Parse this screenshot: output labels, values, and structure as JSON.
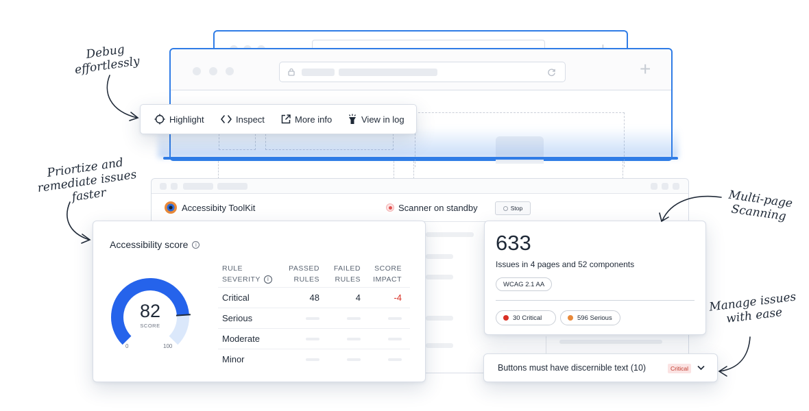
{
  "annotations": {
    "debug": "Debug effortlessly",
    "prioritize": "Priortize and remediate issues faster",
    "multipage": "Multi-page Scanning",
    "manage": "Manage issues with ease"
  },
  "toolbar": {
    "highlight": "Highlight",
    "inspect": "Inspect",
    "more_info": "More info",
    "view_in_log": "View in log"
  },
  "toolkit": {
    "title": "Accessibity ToolKit",
    "status": "Scanner on standby",
    "stop": "Stop"
  },
  "score_card": {
    "title": "Accessibility score",
    "score": "82",
    "score_label": "SCORE",
    "score_fraction": 0.82,
    "gauge_min": "0",
    "gauge_max": "100",
    "headers": {
      "severity_1": "RULE",
      "severity_2": "SEVERITY",
      "passed_1": "PASSED",
      "passed_2": "RULES",
      "failed_1": "FAILED",
      "failed_2": "RULES",
      "impact_1": "SCORE",
      "impact_2": "IMPACT"
    },
    "rows": [
      {
        "severity": "Critical",
        "passed": "48",
        "failed": "4",
        "impact": "-4"
      },
      {
        "severity": "Serious",
        "passed": "",
        "failed": "",
        "impact": ""
      },
      {
        "severity": "Moderate",
        "passed": "",
        "failed": "",
        "impact": ""
      },
      {
        "severity": "Minor",
        "passed": "",
        "failed": "",
        "impact": ""
      }
    ]
  },
  "issues_card": {
    "count": "633",
    "summary": "Issues in 4 pages and 52 components",
    "standard": "WCAG 2.1 AA",
    "critical": "30 Critical",
    "serious": "596 Serious"
  },
  "issue_row": {
    "text": "Buttons must have discernible text (10)",
    "badge": "Critical"
  },
  "colors": {
    "accent": "#2f7ce6",
    "gauge": "#2563eb",
    "gauge_track": "#dbe8fb",
    "critical": "#d93025",
    "serious": "#e8893a"
  }
}
